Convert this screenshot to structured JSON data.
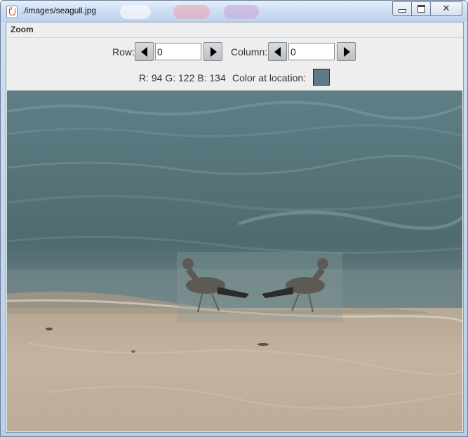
{
  "window": {
    "title": "./images/seagull.jpg",
    "icon": "java-cup-icon"
  },
  "menu": {
    "items": [
      "Zoom"
    ]
  },
  "controls": {
    "row_label": "Row:",
    "row_value": "0",
    "column_label": "Column:",
    "column_value": "0",
    "rgb_text": "R: 94 G: 122 B: 134",
    "color_label": "Color at location:",
    "color_hex": "#5e7a86"
  },
  "image": {
    "description_name": "seagull-beach-picture"
  }
}
